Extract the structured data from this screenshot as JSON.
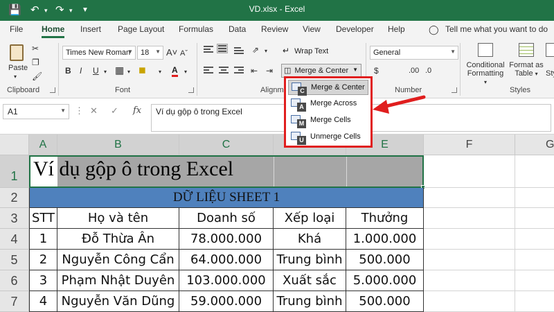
{
  "title_bar": {
    "file_name": "VD.xlsx",
    "separator": "-",
    "app_name": "Excel"
  },
  "tabs": [
    "File",
    "Home",
    "Insert",
    "Page Layout",
    "Formulas",
    "Data",
    "Review",
    "View",
    "Developer",
    "Help"
  ],
  "tell_me": "Tell me what you want to do",
  "ribbon": {
    "paste_label": "Paste",
    "font_name": "Times New Roman",
    "font_size": "18",
    "wrap_text": "Wrap Text",
    "merge_center": "Merge & Center",
    "number_format": "General",
    "conditional_formatting": [
      "Conditional",
      "Formatting"
    ],
    "format_as_table": [
      "Format as",
      "Table"
    ],
    "cell_styles": "Sty",
    "groups": {
      "clipboard": "Clipboard",
      "font": "Font",
      "alignment": "Alignm",
      "number": "Number",
      "styles": "Styles"
    }
  },
  "formula_bar": {
    "name_box": "A1",
    "fx": "fx",
    "formula": "Ví dụ gộp ô trong Excel"
  },
  "merge_menu": {
    "items": [
      {
        "label": "Merge & Center",
        "key": "C",
        "highlighted": true
      },
      {
        "label": "Merge Across",
        "key": "A",
        "highlighted": false
      },
      {
        "label": "Merge Cells",
        "key": "M",
        "highlighted": false
      },
      {
        "label": "Unmerge Cells",
        "key": "U",
        "highlighted": false
      }
    ]
  },
  "sheet": {
    "columns": [
      "A",
      "B",
      "C",
      "D",
      "E",
      "F",
      "G"
    ],
    "rows": [
      "1",
      "2",
      "3",
      "4",
      "5",
      "6",
      "7"
    ],
    "a1_text": "Ví dụ gộp ô trong Excel",
    "header_band": "DỮ LIỆU SHEET 1",
    "header_band_color": "#4f81bd",
    "table_headers": [
      "STT",
      "Họ và tên",
      "Doanh số",
      "Xếp loại",
      "Thưởng"
    ],
    "table_rows": [
      [
        "1",
        "Đỗ Thừa Ân",
        "78.000.000",
        "Khá",
        "1.000.000"
      ],
      [
        "2",
        "Nguyễn Công Cẩn",
        "64.000.000",
        "Trung bình",
        "500.000"
      ],
      [
        "3",
        "Phạm Nhật Duyên",
        "103.000.000",
        "Xuất sắc",
        "5.000.000"
      ],
      [
        "4",
        "Nguyễn Văn Dũng",
        "59.000.000",
        "Trung bình",
        "500.000"
      ]
    ]
  },
  "colors": {
    "excel_green": "#217346",
    "highlight_red": "#e01e1e",
    "merged_fill": "#a6a6a6"
  }
}
